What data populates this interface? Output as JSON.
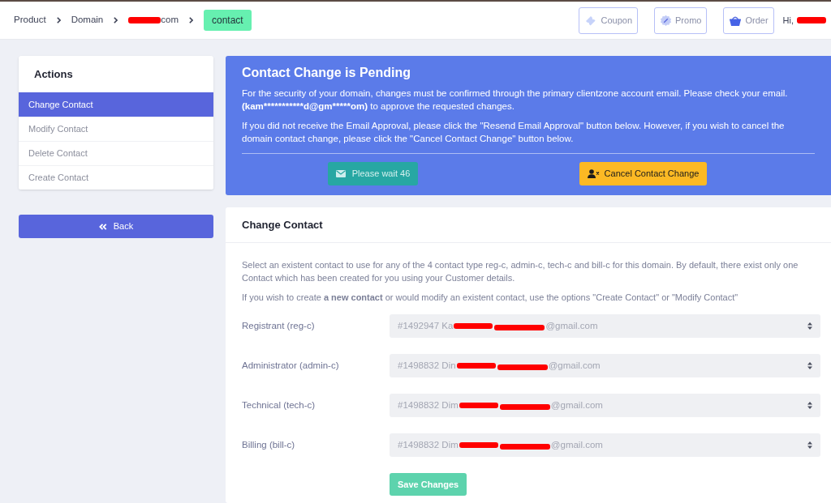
{
  "breadcrumb": [
    {
      "kind": "link",
      "segments": [
        {
          "kind": "text",
          "text": "Product"
        }
      ]
    },
    {
      "kind": "link",
      "segments": [
        {
          "kind": "text",
          "text": "Domain"
        }
      ]
    },
    {
      "kind": "link",
      "segments": [
        {
          "kind": "redaction"
        },
        {
          "kind": "text",
          "text": "com"
        }
      ]
    },
    {
      "kind": "current",
      "segments": [
        {
          "kind": "text",
          "text": "contact"
        }
      ]
    }
  ],
  "header_buttons": [
    {
      "kind": "coupon",
      "label": "Coupon"
    },
    {
      "kind": "promo",
      "label": "Promo"
    },
    {
      "kind": "order",
      "label": "Order"
    }
  ],
  "greeting": {
    "segments": [
      {
        "kind": "text",
        "text": "Hi,"
      },
      {
        "kind": "redaction"
      }
    ]
  },
  "sidebar": {
    "title": "Actions",
    "items": [
      {
        "label": "Change Contact",
        "selected": true
      },
      {
        "label": "Modify Contact",
        "selected": false
      },
      {
        "label": "Delete Contact",
        "selected": false
      },
      {
        "label": "Create Contact",
        "selected": false
      }
    ]
  },
  "back_button": {
    "label": "Back"
  },
  "pending_notice": {
    "title": "Contact Change is Pending",
    "security_text": {
      "before": "For the security of your domain, changes must be confirmed through the primary clientzone account email. Please check your email. ",
      "email": "(kam***********d@gm*****om)",
      "after": " to approve the requested changes."
    },
    "resend_text": "If you did not receive the Email Approval, please click the \"Resend Email Approval\" button below. However, if you wish to cancel the domain contact change, please click the \"Cancel Contact Change\" button below.",
    "buttons": [
      {
        "kind": "wait",
        "label": "Please wait 46"
      },
      {
        "kind": "cancel",
        "label": "Cancel Contact Change"
      }
    ]
  },
  "change_contact": {
    "title": "Change Contact",
    "paragraphs": [
      "Select an existent contact to use for any of the 4 contact type reg-c, admin-c, tech-c and bill-c for this domain. By default, there exist only one Contact which has been created for you using your Customer details.",
      "If you wish to create **a new contact** or would modify an existent contact, use the options \"Create Contact\" or \"Modify Contact\""
    ],
    "fields": [
      {
        "label": "Registrant (reg-c)",
        "segments": [
          {
            "kind": "text",
            "text": "#1492947 Ka"
          },
          {
            "kind": "redaction"
          },
          {
            "kind": "redaction"
          },
          {
            "kind": "text",
            "text": "@gmail.com"
          }
        ]
      },
      {
        "label": "Administrator (admin-c)",
        "segments": [
          {
            "kind": "text",
            "text": "#1498832 Din"
          },
          {
            "kind": "redaction"
          },
          {
            "kind": "redaction"
          },
          {
            "kind": "text",
            "text": "@gmail.com"
          }
        ]
      },
      {
        "label": "Technical (tech-c)",
        "segments": [
          {
            "kind": "text",
            "text": "#1498832 Dim"
          },
          {
            "kind": "redaction"
          },
          {
            "kind": "redaction"
          },
          {
            "kind": "text",
            "text": "@gmail.com"
          }
        ]
      },
      {
        "label": "Billing (bill-c)",
        "segments": [
          {
            "kind": "text",
            "text": "#1498832 Dim"
          },
          {
            "kind": "redaction"
          },
          {
            "kind": "redaction"
          },
          {
            "kind": "text",
            "text": "@gmail.com"
          }
        ]
      }
    ],
    "save_button": {
      "label": "Save Changes"
    }
  }
}
